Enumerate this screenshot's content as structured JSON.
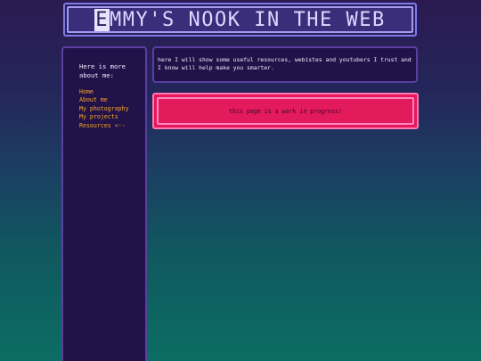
{
  "header": {
    "title_first_letter": "E",
    "title_rest": "MMY'S NOOK IN THE WEB"
  },
  "sidebar": {
    "heading": "Here is more about me:",
    "nav": [
      {
        "label": "Home"
      },
      {
        "label": "About me"
      },
      {
        "label": "My photography"
      },
      {
        "label": "My projects"
      },
      {
        "label": "Resources <--"
      }
    ]
  },
  "main": {
    "intro": "here I will show some useful resources, webistes and youtubers I trust and I know will help make you smarter.",
    "notice": "this page is a work in progress!"
  },
  "colors": {
    "nav_link": "#f5a623",
    "notice_bg": "#e31a5c",
    "panel_bg": "#22124a"
  }
}
